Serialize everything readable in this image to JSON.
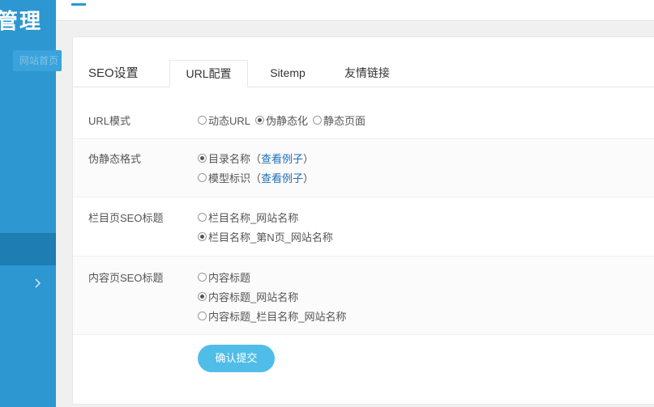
{
  "sidebar": {
    "brand": "管理",
    "home_label": "网站首页"
  },
  "panel": {
    "title": "SEO设置",
    "tabs": [
      "URL配置",
      "Sitemp",
      "友情链接"
    ]
  },
  "form": {
    "url_mode": {
      "label": "URL模式",
      "options": [
        "动态URL",
        "伪静态化",
        "静态页面"
      ],
      "selected": "伪静态化"
    },
    "rewrite_format": {
      "label": "伪静态格式",
      "options": [
        "目录名称",
        "模型标识"
      ],
      "example_link": "查看例子",
      "paren_open": "（",
      "paren_close": "）",
      "selected": "目录名称"
    },
    "category_seo_title": {
      "label": "栏目页SEO标题",
      "options": [
        "栏目名称_网站名称",
        "栏目名称_第N页_网站名称"
      ],
      "selected": "栏目名称_第N页_网站名称"
    },
    "content_seo_title": {
      "label": "内容页SEO标题",
      "options": [
        "内容标题",
        "内容标题_网站名称",
        "内容标题_栏目名称_网站名称"
      ],
      "selected": "内容标题_网站名称"
    },
    "submit_label": "确认提交"
  },
  "colors": {
    "sidebar": "#2c97d0",
    "submit": "#4fbde8",
    "link": "#1e6fb8"
  }
}
